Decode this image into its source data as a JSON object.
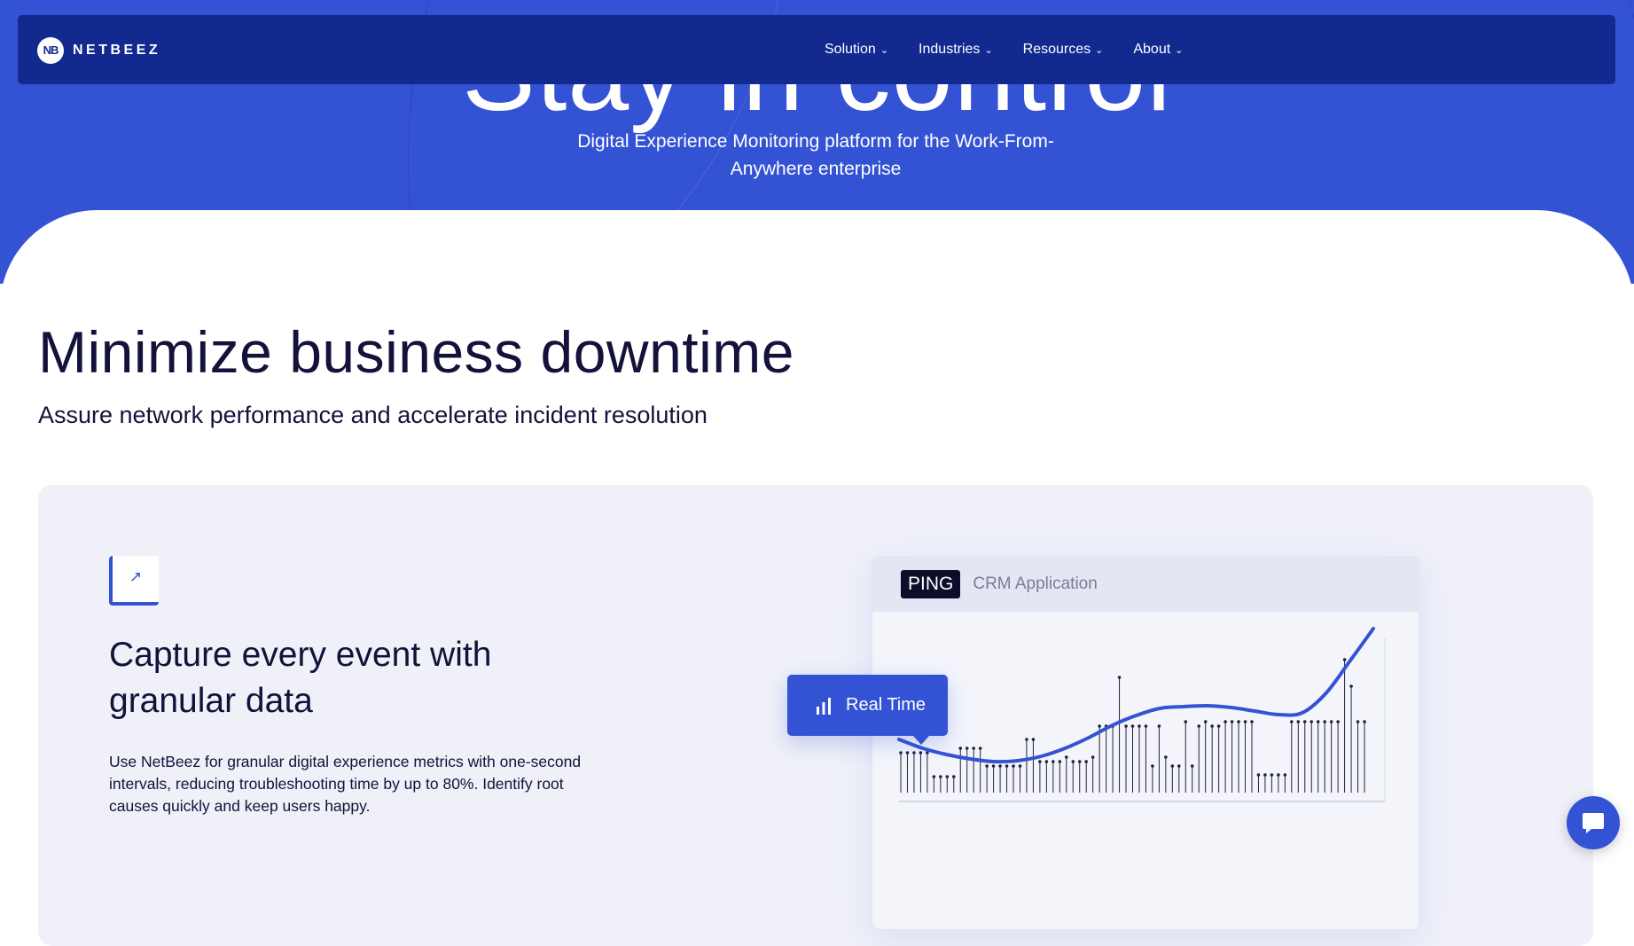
{
  "hero": {
    "headline": "Stay in control",
    "subtitle": "Digital Experience Monitoring platform for the Work-From-Anywhere enterprise"
  },
  "nav": {
    "logo_mark": "NB",
    "logo_text": "NETBEEZ",
    "items": [
      {
        "label": "Solution"
      },
      {
        "label": "Industries"
      },
      {
        "label": "Resources"
      },
      {
        "label": "About"
      }
    ]
  },
  "section": {
    "title": "Minimize business downtime",
    "subtitle": "Assure network performance and accelerate incident resolution"
  },
  "feature": {
    "icon": "compress-arrows-icon",
    "title": "Capture every event with granular data",
    "body": "Use NetBeez for granular digital experience metrics with one-second intervals, reducing troubleshooting time by up to 80%. Identify root causes quickly and keep users happy."
  },
  "chart_card": {
    "badge": "PING",
    "label": "CRM Application",
    "realtime_label": "Real Time",
    "accent_color": "#3452d4"
  },
  "chart_data": {
    "type": "line",
    "title": "",
    "samples": [
      45,
      45,
      45,
      45,
      45,
      18,
      18,
      18,
      18,
      50,
      50,
      50,
      50,
      30,
      30,
      30,
      30,
      30,
      30,
      60,
      60,
      35,
      35,
      35,
      35,
      40,
      35,
      35,
      35,
      40,
      75,
      75,
      75,
      130,
      75,
      75,
      75,
      75,
      30,
      75,
      40,
      30,
      30,
      80,
      30,
      75,
      80,
      75,
      75,
      80,
      80,
      80,
      80,
      80,
      20,
      20,
      20,
      20,
      20,
      80,
      80,
      80,
      80,
      80,
      80,
      80,
      80,
      150,
      120,
      80,
      80
    ],
    "trend": [
      60,
      50,
      43,
      38,
      35,
      36,
      41,
      50,
      62,
      76,
      87,
      95,
      97,
      98,
      96,
      92,
      88,
      90,
      112,
      148,
      185
    ]
  },
  "chat": {
    "icon": "chat-bubble-icon"
  }
}
